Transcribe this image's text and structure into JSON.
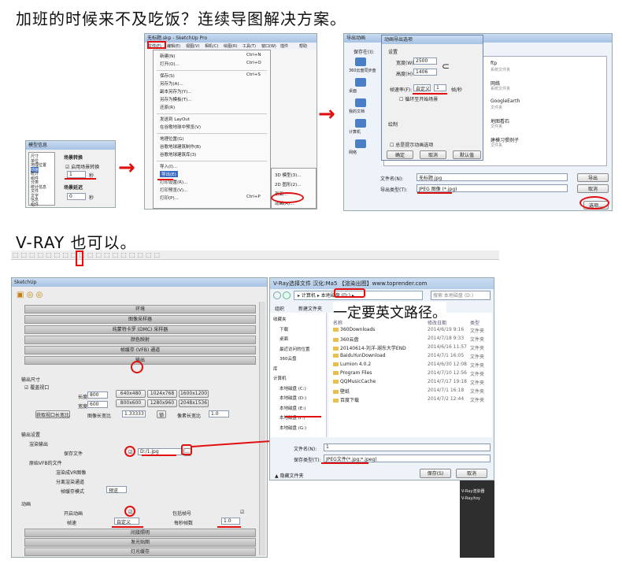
{
  "headings": {
    "top": "加班的时候来不及吃饭？连续导图解决方案。",
    "mid": "V-RAY 也可以。"
  },
  "model_info": {
    "title": "模型信息",
    "list": [
      "尺寸",
      "单位",
      "地理位置",
      "动画",
      "统计",
      "组件",
      "分类",
      "统计信息",
      "文件",
      "文字",
      "信息",
      "组件"
    ],
    "section1": "场景转换",
    "checkbox": "启用场景转换",
    "val1": "1",
    "unit1": "秒",
    "section2": "场景延迟",
    "val2": "0",
    "unit2": "秒"
  },
  "menu": {
    "window_title": "无标题.skp - SketchUp Pro",
    "menubar": [
      "文件(F)",
      "编辑(E)",
      "视图(V)",
      "相机(C)",
      "绘图(R)",
      "工具(T)",
      "窗口(W)",
      "插件",
      "帮助"
    ],
    "items": [
      {
        "label": "新建(N)",
        "shortcut": "Ctrl+N"
      },
      {
        "label": "打开(O)...",
        "shortcut": "Ctrl+O"
      },
      {
        "label": "保存(S)",
        "shortcut": "Ctrl+S"
      },
      {
        "label": "另存为(A)...",
        "shortcut": ""
      },
      {
        "label": "副本另存为(Y)...",
        "shortcut": ""
      },
      {
        "label": "另存为模板(T)...",
        "shortcut": ""
      },
      {
        "label": "还原(R)",
        "shortcut": ""
      },
      {
        "label": "发送到 LayOut",
        "shortcut": ""
      },
      {
        "label": "在谷歌地球中预览(V)",
        "shortcut": ""
      },
      {
        "label": "地理位置(G)",
        "shortcut": ""
      },
      {
        "label": "谷歌地球建筑制作(B)",
        "shortcut": ""
      },
      {
        "label": "谷歌地球建筑库(3)",
        "shortcut": ""
      },
      {
        "label": "导入(I)...",
        "shortcut": ""
      },
      {
        "label": "导出(E)",
        "shortcut": ""
      },
      {
        "label": "打印设置(R)...",
        "shortcut": ""
      },
      {
        "label": "打印预览(V)...",
        "shortcut": ""
      },
      {
        "label": "打印(P)...",
        "shortcut": "Ctrl+P"
      }
    ],
    "submenu": [
      "3D 模型(3)...",
      "2D 图形(2)...",
      "剖面...",
      "动画(A)..."
    ]
  },
  "export_dialog": {
    "title": "导出动画",
    "save_in": "保存在(I):",
    "sidebar": [
      "360云盘同步盘",
      "桌面",
      "我的文档",
      "计算机",
      "网络"
    ],
    "files": [
      {
        "name": "ftp",
        "type": "系统文件夹"
      },
      {
        "name": "网络",
        "type": "系统文件夹"
      },
      {
        "name": "GoogleEarth",
        "type": "文件夹"
      },
      {
        "name": "地图看石",
        "type": "文件夹"
      },
      {
        "name": "建模习惯例子",
        "type": "文件夹"
      }
    ],
    "filename_label": "文件名(N):",
    "filename": "无标题.jpg",
    "type_label": "导出类型(T):",
    "type_value": "JPEG 图像 (*.jpg)",
    "export_btn": "导出",
    "cancel_btn": "取消",
    "options_btn": "选项..."
  },
  "anim_options": {
    "title": "动画导出选项",
    "settings": "设置",
    "width_label": "宽度(W):",
    "width": "2500",
    "height_label": "高度(H):",
    "height": "1406",
    "fps_label": "帧速率(F):",
    "fps_preset": "自定义",
    "fps": "1",
    "fps_unit": "帧/秒",
    "loop": "循环至开始场景",
    "render": "绘制",
    "always_prompt": "总是提示动画选项",
    "ok": "确定",
    "cancel": "取消",
    "default": "默认值"
  },
  "vray_toolbar": "V-Ray toolbar",
  "vray_panel": {
    "title": "SketchUp",
    "bars_top": [
      "环境",
      "图像采样器",
      "纯蒙特卡罗 (DMC) 采样器",
      "颜色映射",
      "帧缓存 (VFB) 通道",
      "输出"
    ],
    "output_size": "输出尺寸",
    "override": "覆盖视口",
    "length_label": "长度",
    "length": "800",
    "width_label": "宽度",
    "width": "600",
    "presets": [
      "640x480",
      "1024x768",
      "1600x1200",
      "800x600",
      "1280x960",
      "2048x1536"
    ],
    "get_ratio": "获取视口长宽比",
    "img_ratio_label": "图像长宽比",
    "img_ratio": "1.33333",
    "lock": "锁",
    "pixel_ratio_label": "像素长宽比",
    "pixel_ratio": "1.0",
    "output_settings": "输出设置",
    "render_output": "渲染输出",
    "save_file": "保存文件",
    "save_path": "D:/1.jpg",
    "raw_file": "原始VFB的文件",
    "render_raw": "渲染成VR图像",
    "split_ch": "分离渲染通道",
    "frame_fmt": "帧缓存模式",
    "frame_fmt_val": "预览",
    "animation": "动画",
    "enable_anim": "开启动画",
    "include_frame": "包括帧号",
    "frame_rate_label": "帧速",
    "frame_rate": "自定义",
    "fps_label": "每秒帧数",
    "fps": "1.0",
    "bars_bottom": [
      "间接照明",
      "发光贴图",
      "灯光缓存"
    ]
  },
  "vray_dialog": {
    "title": "V-Ray选择文件  汉化:Ma5   【渲染出图】www.toprender.com",
    "path": [
      "计算机",
      "本地磁盘 (D:)"
    ],
    "search": "搜索 本地磁盘 (D:)",
    "annotation": "一定要英文路径。",
    "toolbar": [
      "组织",
      "新建文件夹"
    ],
    "sidebar": [
      "收藏夹",
      "下载",
      "桌面",
      "最近访问的位置",
      "360云盘",
      "库",
      "计算机",
      "本地磁盘 (C:)",
      "本地磁盘 (D:)",
      "本地磁盘 (E:)",
      "本地磁盘 (F:)",
      "本地磁盘 (G:)"
    ],
    "col_headers": [
      "名称",
      "修改日期",
      "类型"
    ],
    "files": [
      {
        "name": "360Downloads",
        "date": "2014/6/19 9:16",
        "type": "文件夹"
      },
      {
        "name": "360云盘",
        "date": "2014/7/18 9:33",
        "type": "文件夹"
      },
      {
        "name": "20140614-刘洋-湖东大学END",
        "date": "2014/6/16 11:57",
        "type": "文件夹"
      },
      {
        "name": "BaiduYunDownload",
        "date": "2014/7/1 16:05",
        "type": "文件夹"
      },
      {
        "name": "Lumion 4.0.2",
        "date": "2014/6/30 12:08",
        "type": "文件夹"
      },
      {
        "name": "Program Files",
        "date": "2014/7/10 12:56",
        "type": "文件夹"
      },
      {
        "name": "QQMusicCache",
        "date": "2014/7/17 19:18",
        "type": "文件夹"
      },
      {
        "name": "壁纸",
        "date": "2014/7/1 16:18",
        "type": "文件夹"
      },
      {
        "name": "百度下载",
        "date": "2014/7/2 12:44",
        "type": "文件夹"
      }
    ],
    "filename_label": "文件名(N):",
    "filename": "1",
    "type_label": "保存类型(T):",
    "type_value": "JPEG文件(*.jpg;*.jpeg)",
    "hide_folders": "隐藏文件夹",
    "save": "保存(S)",
    "cancel": "取消",
    "vray_side": [
      "V-Ray渲染器",
      "V-Ray/toy"
    ]
  },
  "colors": {
    "annotation_red": "#e01010",
    "title_blue": "#b4cce8",
    "folder": "#e8c050"
  }
}
